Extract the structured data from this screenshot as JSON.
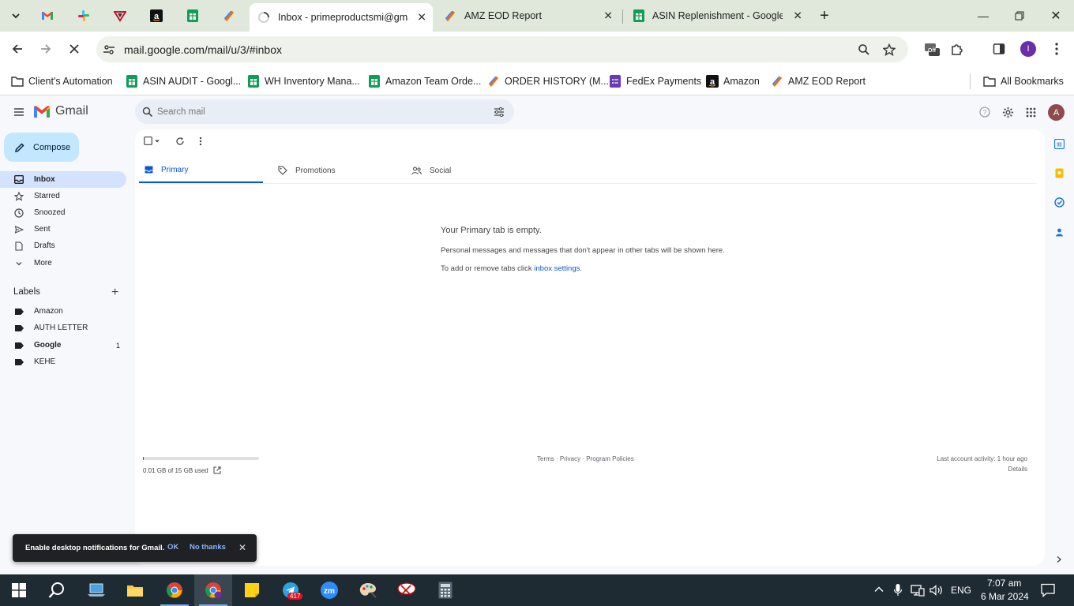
{
  "browser": {
    "tabs": [
      {
        "title": "Inbox - primeproductsmi@gmail.com",
        "active": true
      },
      {
        "title": "AMZ EOD Report",
        "active": false
      },
      {
        "title": "ASIN Replenishment - Google Sheets",
        "active": false
      }
    ],
    "url": "mail.google.com/mail/u/3/#inbox",
    "bookmarks": [
      {
        "label": "Client's Automation",
        "icon": "folder-icon"
      },
      {
        "label": "ASIN AUDIT - Googl...",
        "icon": "sheets-icon"
      },
      {
        "label": "WH Inventory Mana...",
        "icon": "sheets-icon"
      },
      {
        "label": "Amazon Team Orde...",
        "icon": "sheets-icon"
      },
      {
        "label": "ORDER HISTORY (M...",
        "icon": "zapier-icon"
      },
      {
        "label": "FedEx Payments",
        "icon": "forms-icon"
      },
      {
        "label": "Amazon",
        "icon": "amazon-icon"
      },
      {
        "label": "AMZ EOD Report",
        "icon": "zapier-icon"
      },
      {
        "label": "All Bookmarks",
        "icon": "folder-icon"
      }
    ],
    "extension_badge": "Off",
    "profile_initial": "I"
  },
  "gmail": {
    "logo_text": "Gmail",
    "search_placeholder": "Search mail",
    "avatar_initial": "A",
    "compose_label": "Compose",
    "nav": [
      {
        "label": "Inbox",
        "icon": "inbox-icon"
      },
      {
        "label": "Starred",
        "icon": "star-icon"
      },
      {
        "label": "Snoozed",
        "icon": "clock-icon"
      },
      {
        "label": "Sent",
        "icon": "send-icon"
      },
      {
        "label": "Drafts",
        "icon": "draft-icon"
      },
      {
        "label": "More",
        "icon": "chevron-down-icon"
      }
    ],
    "labels_heading": "Labels",
    "labels": [
      {
        "label": "Amazon",
        "count": ""
      },
      {
        "label": "AUTH LETTER",
        "count": ""
      },
      {
        "label": "Google",
        "count": "1"
      },
      {
        "label": "KEHE",
        "count": ""
      }
    ],
    "tabs": [
      {
        "label": "Primary",
        "icon": "inbox-icon"
      },
      {
        "label": "Promotions",
        "icon": "tag-icon"
      },
      {
        "label": "Social",
        "icon": "people-icon"
      }
    ],
    "empty": {
      "title": "Your Primary tab is empty.",
      "line1": "Personal messages and messages that don't appear in other tabs will be shown here.",
      "line2_prefix": "To add or remove tabs click ",
      "line2_link": "inbox settings",
      "line2_suffix": "."
    },
    "storage": {
      "text": "0.01 GB of 15 GB used",
      "fraction": 0.0007
    },
    "footer": {
      "links": "Terms · Privacy · Program Policies",
      "activity": "Last account activity: 1 hour ago",
      "details": "Details"
    },
    "snackbar": {
      "message": "Enable desktop notifications for Gmail.",
      "ok": "OK",
      "no_thanks": "No thanks"
    }
  },
  "taskbar": {
    "telegram_badge": "417",
    "language": "ENG",
    "time": "7:07 am",
    "date": "6 Mar 2024"
  },
  "colors": {
    "tabstrip": "#dfe8da",
    "compose": "#c2e7ff",
    "nav_active": "#d3e3fd",
    "accent": "#0b57d0",
    "taskbar": "#1f2b33"
  }
}
